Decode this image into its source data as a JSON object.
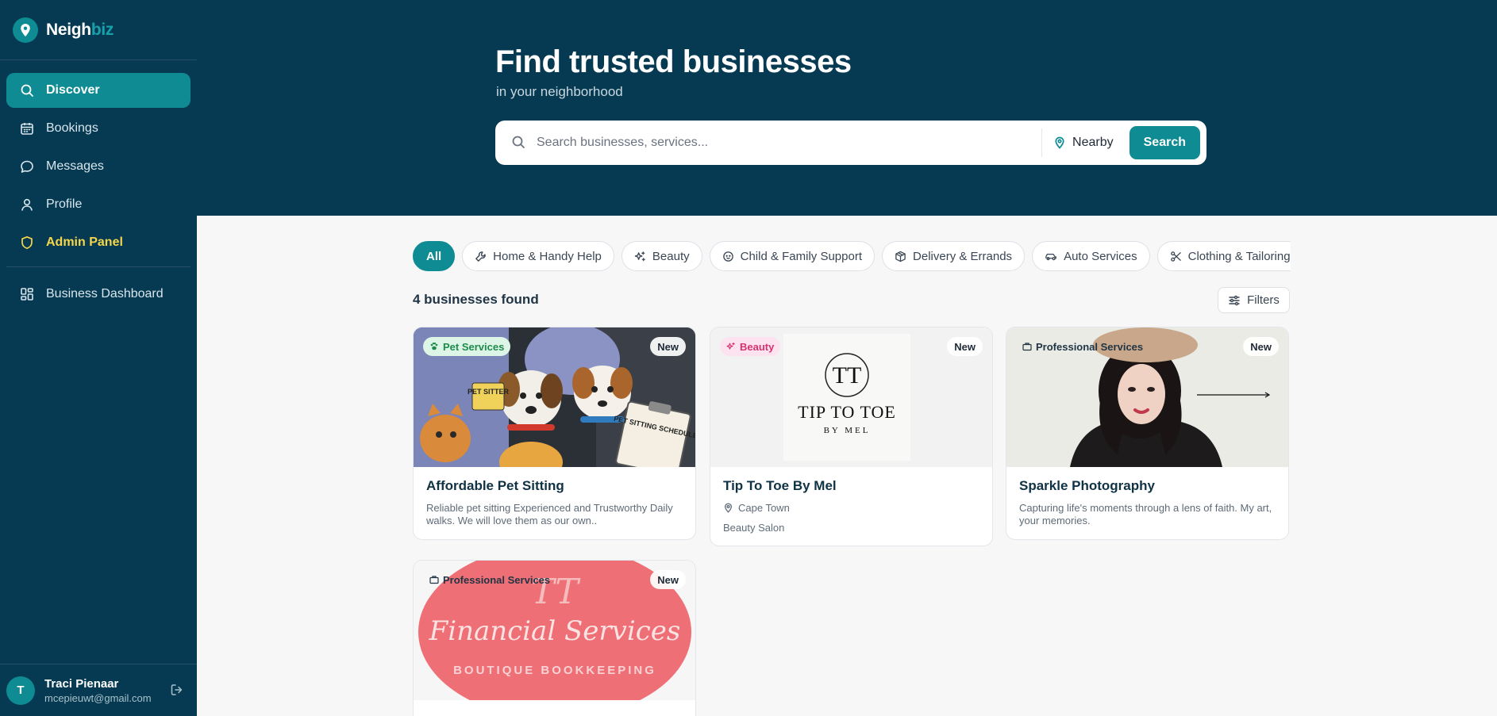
{
  "brand": {
    "name_main": "Neigh",
    "name_accent": "biz"
  },
  "sidebar": {
    "nav": [
      {
        "label": "Discover",
        "icon": "search-icon",
        "active": true
      },
      {
        "label": "Bookings",
        "icon": "calendar-icon"
      },
      {
        "label": "Messages",
        "icon": "chat-bubble-icon"
      },
      {
        "label": "Profile",
        "icon": "user-icon"
      },
      {
        "label": "Admin Panel",
        "icon": "shield-icon"
      }
    ],
    "business_dashboard": {
      "label": "Business Dashboard",
      "icon": "grid-icon"
    },
    "user": {
      "initial": "T",
      "name": "Traci Pienaar",
      "email": "mcepieuwt@gmail.com"
    }
  },
  "hero": {
    "title": "Find trusted businesses",
    "subtitle": "in your neighborhood",
    "search_placeholder": "Search businesses, services...",
    "location_label": "Nearby",
    "search_button": "Search"
  },
  "categories": [
    {
      "label": "All",
      "active": true
    },
    {
      "label": "Home & Handy Help",
      "icon": "wrench-icon"
    },
    {
      "label": "Beauty",
      "icon": "sparkles-icon"
    },
    {
      "label": "Child & Family Support",
      "icon": "baby-icon"
    },
    {
      "label": "Delivery & Errands",
      "icon": "package-icon"
    },
    {
      "label": "Auto Services",
      "icon": "car-icon"
    },
    {
      "label": "Clothing & Tailoring",
      "icon": "scissors-icon"
    }
  ],
  "results": {
    "count_label": "4 businesses found",
    "filters_label": "Filters"
  },
  "businesses": [
    {
      "category": "Pet Services",
      "badge": "New",
      "title": "Affordable Pet Sitting",
      "description": "Reliable pet sitting Experienced and Trustworthy Daily walks. We will love them as our own..",
      "image_text_1": "PET SITTER",
      "image_text_2": "PET SITTING SCHEDULE"
    },
    {
      "category": "Beauty",
      "badge": "New",
      "title": "Tip To Toe By Mel",
      "location": "Cape Town",
      "type": "Beauty Salon",
      "logo_monogram": "TT",
      "logo_title": "TIP TO TOE",
      "logo_sub": "BY MEL"
    },
    {
      "category": "Professional Services",
      "badge": "New",
      "title": "Sparkle Photography",
      "description": "Capturing life's moments through a lens of faith. My art, your memories."
    },
    {
      "category": "Professional Services",
      "badge": "New",
      "image_monogram": "TT",
      "image_script": "Financial Services",
      "image_sub": "BOUTIQUE BOOKKEEPING"
    }
  ],
  "colors": {
    "primary": "#0e8b93",
    "navy": "#063a52",
    "admin": "#f5d64a",
    "pet_badge_bg": "#dcf5e6",
    "pet_badge_fg": "#1e8a4c",
    "beauty_badge_bg": "#fde3ef",
    "beauty_badge_fg": "#d6336c"
  }
}
